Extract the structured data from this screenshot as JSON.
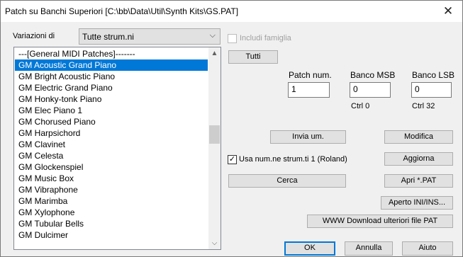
{
  "window": {
    "title": "Patch su Banchi Superiori [C:\\bb\\Data\\Util\\Synth Kits\\GS.PAT]",
    "close_glyph": "✕"
  },
  "variations": {
    "label": "Variazioni di",
    "selected": "Tutte strum.ni"
  },
  "include_family": {
    "label": "Includi famiglia",
    "checked": false,
    "enabled": false
  },
  "patch_list": {
    "header": "---[General MIDI Patches]-------",
    "items": [
      "GM Acoustic Grand Piano",
      "GM Bright Acoustic Piano",
      "GM Electric Grand Piano",
      "GM Honky-tonk Piano",
      "GM Elec Piano 1",
      "GM Chorused Piano",
      "GM Harpsichord",
      "GM Clavinet",
      "GM Celesta",
      "GM Glockenspiel",
      "GM Music Box",
      "GM Vibraphone",
      "GM Marimba",
      "GM Xylophone",
      "GM Tubular Bells",
      "GM Dulcimer"
    ],
    "selected_index": 0
  },
  "buttons": {
    "all": "Tutti",
    "send": "Invia um.",
    "modify": "Modifica",
    "update": "Aggiorna",
    "search": "Cerca",
    "open_pat": "Apri *.PAT",
    "open_ini": "Aperto INI/INS...",
    "download": "WWW Download ulteriori file PAT",
    "ok": "OK",
    "cancel": "Annulla",
    "help": "Aiuto"
  },
  "patch_num": {
    "label": "Patch num.",
    "value": "1"
  },
  "bank_msb": {
    "label": "Banco MSB",
    "value": "0",
    "ctrl": "Ctrl 0"
  },
  "bank_lsb": {
    "label": "Banco LSB",
    "value": "0",
    "ctrl": "Ctrl 32"
  },
  "roland": {
    "label": "Usa num.ne strum.ti 1 (Roland)",
    "checked": true
  }
}
